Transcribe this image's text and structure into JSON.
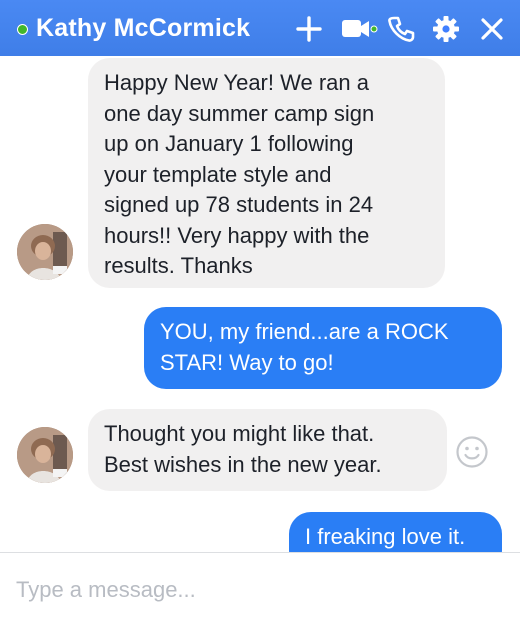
{
  "header": {
    "contact_name": "Kathy McCormick",
    "status": "online",
    "background_color": "#4080ff",
    "status_color": "#42b72a",
    "icons": [
      "add-icon",
      "video-call-icon",
      "phone-icon",
      "gear-icon",
      "close-icon"
    ]
  },
  "messages": [
    {
      "sender": "contact",
      "text": "Happy New Year! We ran a\none day summer camp sign\nup on January 1 following\nyour template style and\nsigned up 78 students in  24\nhours!! Very happy with the\nresults. Thanks"
    },
    {
      "sender": "me",
      "text": "YOU, my friend...are a ROCK\nSTAR!  Way to go!"
    },
    {
      "sender": "contact",
      "text": "Thought you might like that.\nBest wishes in the new year."
    },
    {
      "sender": "me",
      "text": "I freaking love it."
    }
  ],
  "colors": {
    "incoming_bubble": "#f1f0f0",
    "outgoing_bubble": "#2a7ef5",
    "incoming_text": "#1d2129",
    "outgoing_text": "#ffffff"
  },
  "composer": {
    "placeholder": "Type a message...",
    "value": ""
  }
}
